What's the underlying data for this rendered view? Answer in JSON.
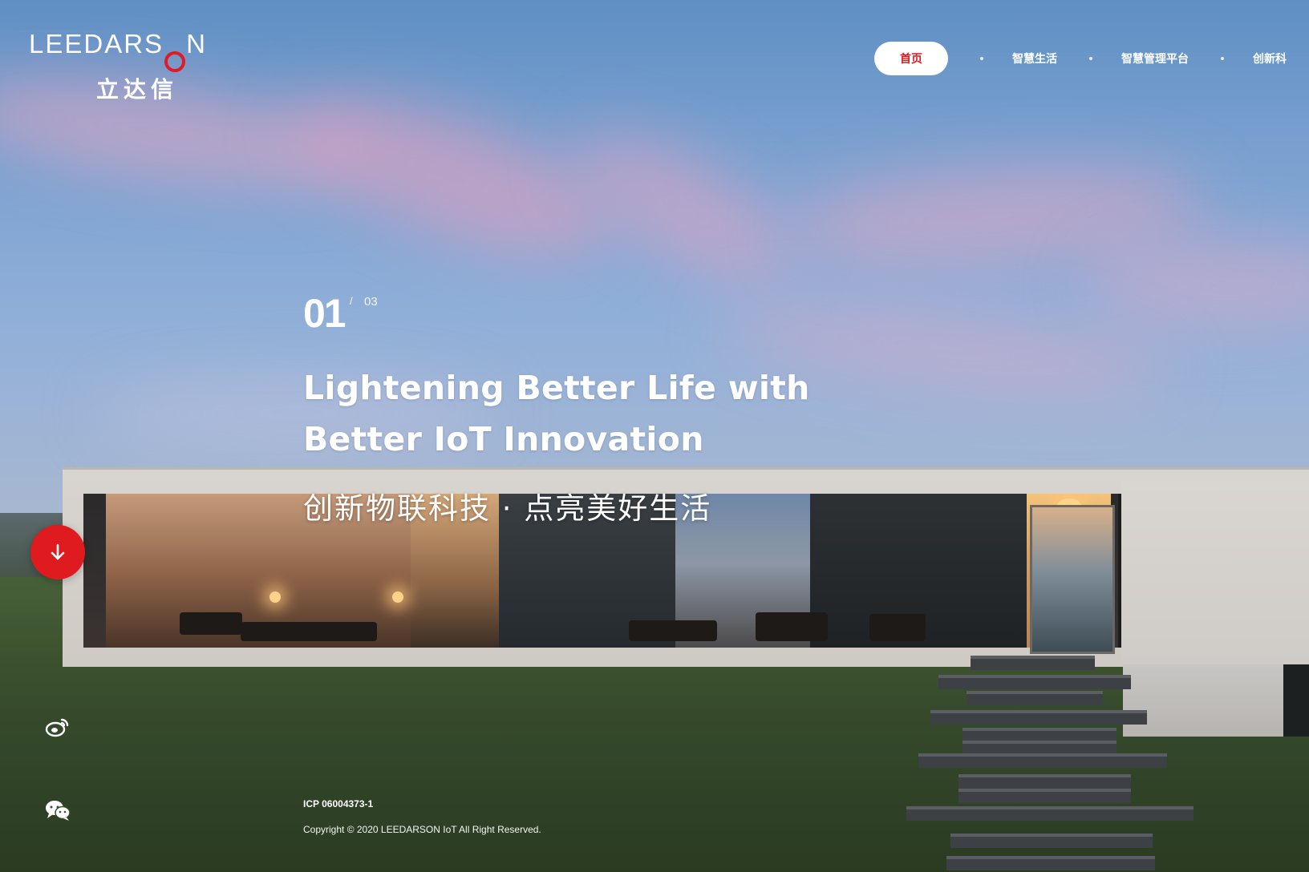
{
  "brand": {
    "name_en_left": "LEEDARS",
    "name_en_right": "N",
    "name_cn": "立达信",
    "accent_color": "#e11b22"
  },
  "nav": {
    "active": "首页",
    "items": [
      "智慧生活",
      "智慧管理平台",
      "创新科"
    ]
  },
  "hero": {
    "slide_current": "01",
    "slide_separator": "/",
    "slide_total": "03",
    "headline_line1": "Lightening Better Life with",
    "headline_line2": "Better IoT Innovation",
    "subheadline": "创新物联科技 · 点亮美好生活"
  },
  "side": {
    "scroll_icon": "arrow-down-icon",
    "social_icons": [
      "weibo-icon",
      "wechat-icon"
    ]
  },
  "footer": {
    "icp": "ICP 06004373-1",
    "copyright": "Copyright © 2020 LEEDARSON IoT All Right Reserved."
  }
}
